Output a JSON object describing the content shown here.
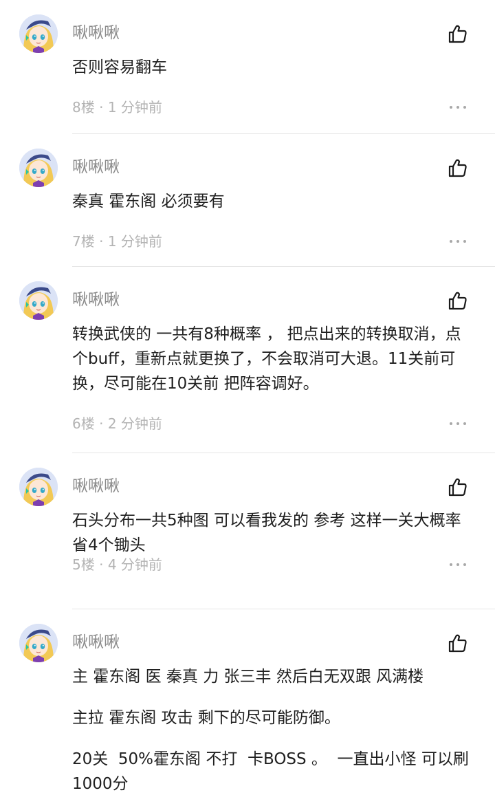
{
  "comments": [
    {
      "username": "啾啾啾",
      "paragraphs": [
        "否则容易翻车"
      ],
      "floor": "8楼",
      "time": "1 分钟前"
    },
    {
      "username": "啾啾啾",
      "paragraphs": [
        "秦真 霍东阁 必须要有"
      ],
      "floor": "7楼",
      "time": "1 分钟前"
    },
    {
      "username": "啾啾啾",
      "paragraphs": [
        "转换武侠的 一共有8种概率 ， 把点出来的转换取消，点个buff，重新点就更换了，不会取消可大退。11关前可换，尽可能在10关前 把阵容调好。"
      ],
      "floor": "6楼",
      "time": "2 分钟前"
    },
    {
      "username": "啾啾啾",
      "paragraphs": [
        "石头分布一共5种图 可以看我发的 参考 这样一关大概率省4个锄头"
      ],
      "floor": "5楼",
      "time": "4 分钟前"
    },
    {
      "username": "啾啾啾",
      "paragraphs": [
        "主 霍东阁 医 秦真 力 张三丰 然后白无双跟 风满楼",
        "主拉 霍东阁 攻击 剩下的尽可能防御。",
        "20关  50%霍东阁 不打  卡BOSS 。  一直出小怪 可以刷1000分"
      ],
      "floor": "",
      "time": ""
    }
  ],
  "icons": {
    "avatar": "anime-avatar-icon",
    "like": "thumbs-up-icon",
    "more": "more-dots-icon"
  },
  "colors": {
    "username": "#8a8a8a",
    "meta": "#b3b3b3",
    "text": "#1f1f1f",
    "divider": "#e6e6e6"
  }
}
